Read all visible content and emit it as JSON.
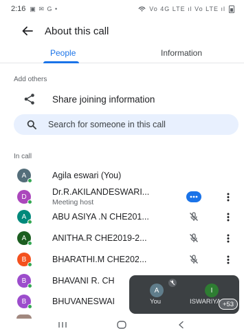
{
  "status_bar": {
    "time": "2:16",
    "left_icons": "▣ ✉ G •",
    "right_icons": "Vo 4G LTE ıl Vo LTE ıl"
  },
  "app_bar": {
    "title": "About this call",
    "back_icon": "arrow-back-icon"
  },
  "tabs": [
    {
      "label": "People",
      "active": true
    },
    {
      "label": "Information",
      "active": false
    }
  ],
  "add_others": {
    "section_label": "Add others",
    "share_label": "Share joining information",
    "search_placeholder": "Search for someone in this call"
  },
  "in_call": {
    "section_label": "In call",
    "participants": [
      {
        "initial": "A",
        "color": "#546e7a",
        "name": "Agila eswari (You)",
        "subtitle": "",
        "status": "none",
        "more": false
      },
      {
        "initial": "D",
        "color": "#ab47bc",
        "name": "Dr.R.AKILANDESWARI...",
        "subtitle": "Meeting host",
        "status": "host",
        "more": true
      },
      {
        "initial": "A",
        "color": "#00897b",
        "name": "ABU ASIYA .N CHE201...",
        "subtitle": "",
        "status": "mic-off",
        "more": true
      },
      {
        "initial": "A",
        "color": "#1b5e20",
        "name": "ANITHA.R CHE2019-2...",
        "subtitle": "",
        "status": "mic-off",
        "more": true
      },
      {
        "initial": "B",
        "color": "#f4511e",
        "name": "BHARATHI.M CHE202...",
        "subtitle": "",
        "status": "mic-off",
        "more": true
      },
      {
        "initial": "B",
        "color": "#9c4dcc",
        "name": "BHAVANI R. CH",
        "subtitle": "",
        "status": "none",
        "more": false
      },
      {
        "initial": "B",
        "color": "#9c4dcc",
        "name": "BHUVANESWAI",
        "subtitle": "",
        "status": "none",
        "more": false
      }
    ]
  },
  "pip": {
    "you_initial": "A",
    "you_label": "You",
    "other_initial": "I",
    "other_label": "ISWARIYA",
    "overflow_count": "+53",
    "you_color": "#607d8b",
    "other_color": "#2e7d32"
  },
  "nav_bar": {
    "buttons": [
      "recent-apps-icon",
      "home-icon",
      "back-icon"
    ]
  }
}
